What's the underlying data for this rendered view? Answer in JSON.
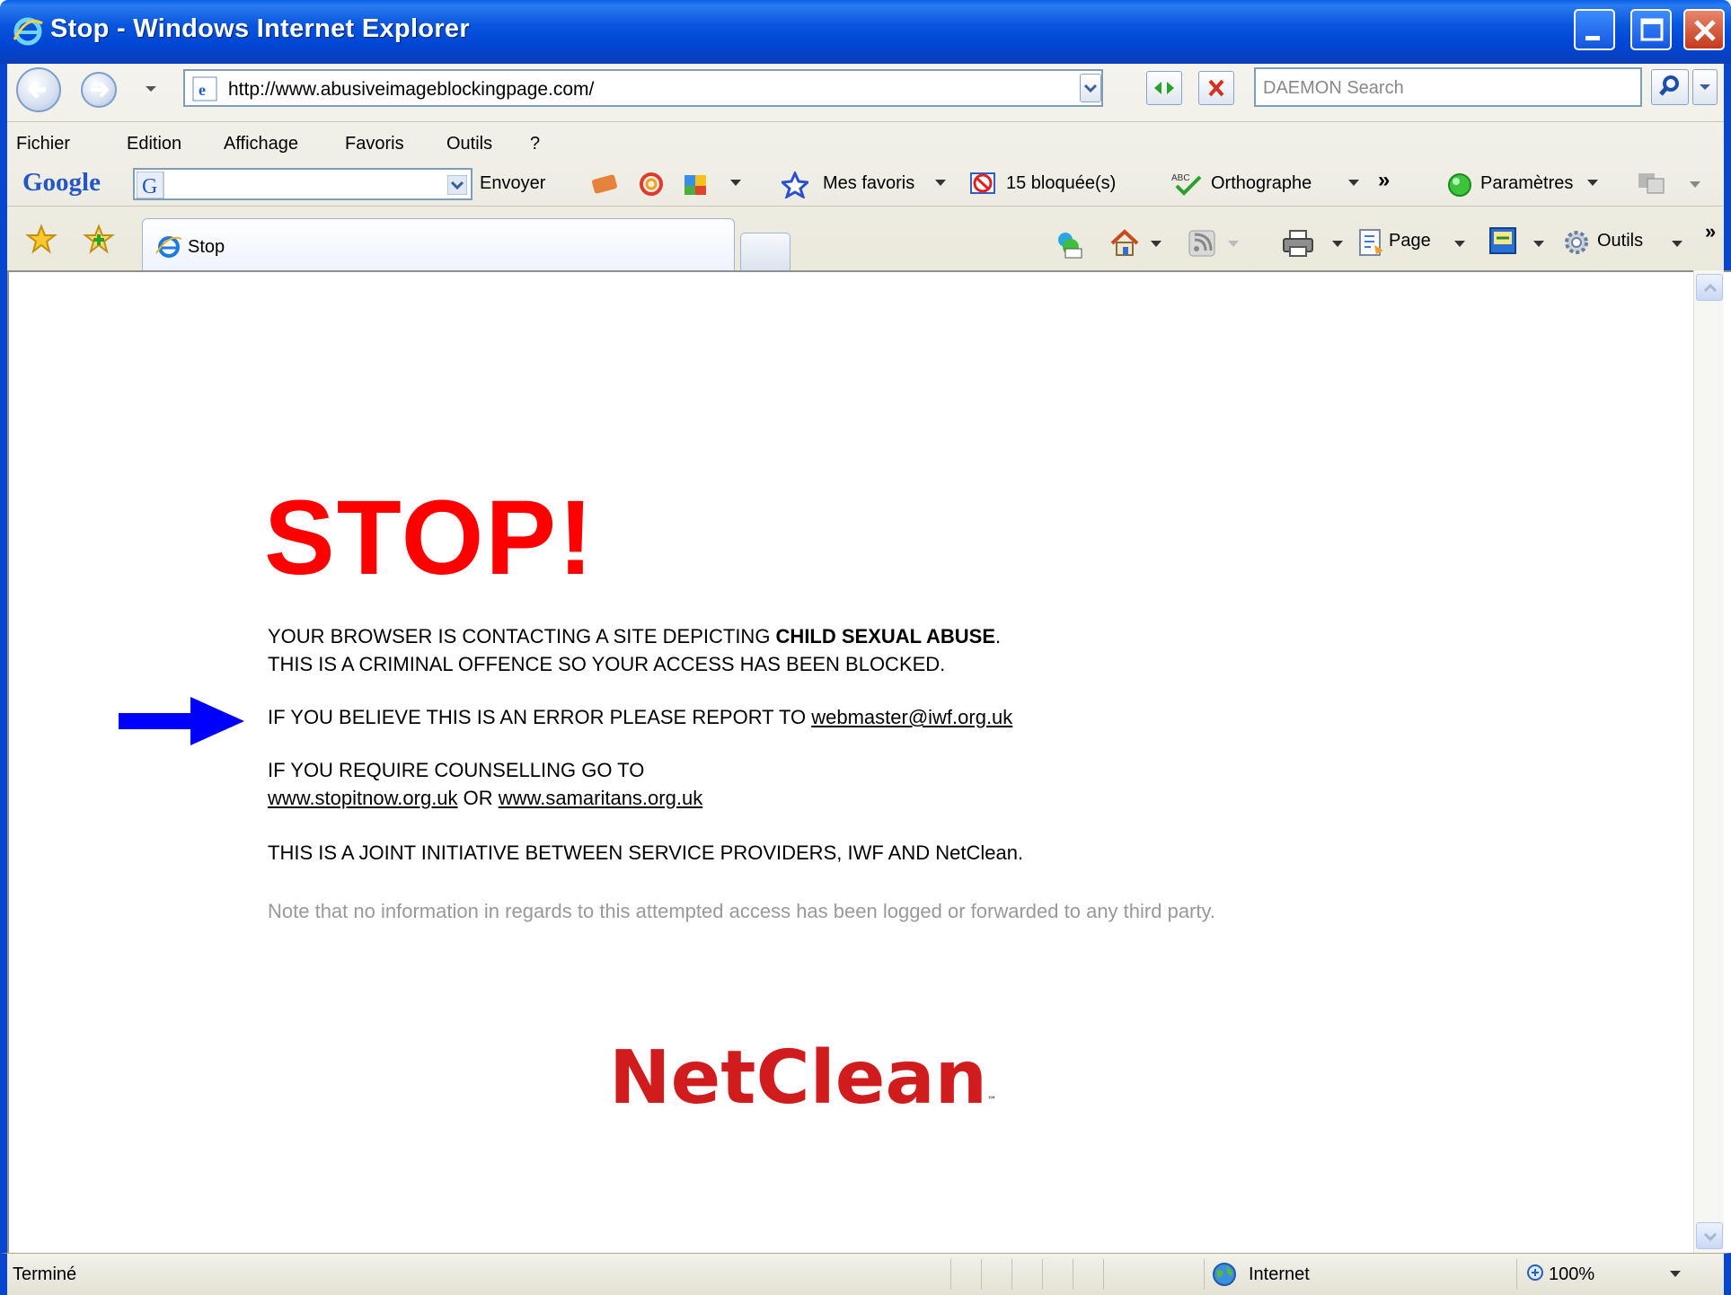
{
  "window": {
    "title": "Stop - Windows Internet Explorer"
  },
  "address_bar": {
    "url": "http://www.abusiveimageblockingpage.com/",
    "search_placeholder": "DAEMON Search"
  },
  "menu": {
    "items": [
      "Fichier",
      "Edition",
      "Affichage",
      "Favoris",
      "Outils",
      "?"
    ]
  },
  "google_toolbar": {
    "logo": "Google",
    "send_label": "Envoyer",
    "favorites_label": "Mes favoris",
    "blocked_label": "15 bloquée(s)",
    "spelling_label": "Orthographe",
    "overflow_label": "»",
    "settings_label": "Paramètres"
  },
  "tabs": {
    "active_label": "Stop"
  },
  "command_bar": {
    "page_label": "Page",
    "tools_label": "Outils",
    "overflow_label": "»"
  },
  "page": {
    "heading": "STOP!",
    "line1_prefix": "YOUR BROWSER IS CONTACTING A SITE DEPICTING ",
    "line1_bold": "CHILD SEXUAL ABUSE",
    "line1_suffix": ".",
    "line2": "THIS IS A CRIMINAL OFFENCE SO YOUR ACCESS HAS BEEN BLOCKED.",
    "report_prefix": "IF YOU BELIEVE THIS IS AN ERROR PLEASE REPORT TO ",
    "report_email": "webmaster@iwf.org.uk",
    "counselling_line": "IF YOU REQUIRE COUNSELLING GO TO",
    "link1": "www.stopitnow.org.uk",
    "or_text": " OR ",
    "link2": "www.samaritans.org.uk",
    "joint_initiative": "THIS IS A JOINT INITIATIVE BETWEEN SERVICE PROVIDERS, IWF AND NetClean.",
    "note": "Note that no information in regards to this attempted access has been logged or forwarded to any third party.",
    "brand_logo": "NetClean",
    "brand_tm": "™"
  },
  "status_bar": {
    "status": "Terminé",
    "zone": "Internet",
    "zoom": "100%"
  },
  "colors": {
    "stop_red": "#ff0000",
    "netclean_red": "#d01c1c",
    "arrow_blue": "#0000ff",
    "xp_blue": "#0846d0"
  },
  "icons": {
    "back": "back-arrow-icon",
    "forward": "forward-arrow-icon",
    "refresh": "refresh-icon",
    "stop": "stop-x-icon",
    "search": "magnifier-icon",
    "favorites": "star-icon",
    "home": "home-icon",
    "print": "printer-icon",
    "tools": "gear-icon",
    "zone": "globe-icon",
    "zoom": "zoom-icon"
  }
}
